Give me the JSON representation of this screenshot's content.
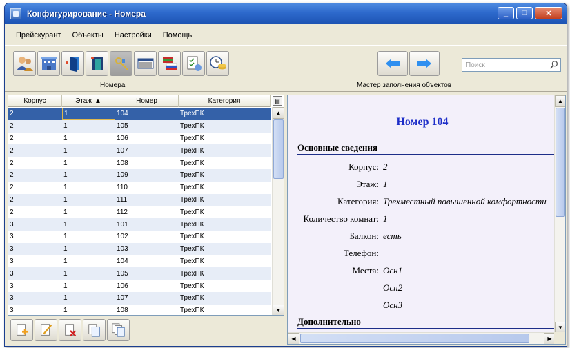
{
  "window": {
    "title": "Конфигурирование - Номера"
  },
  "menu": [
    "Прейскурант",
    "Объекты",
    "Настройки",
    "Помощь"
  ],
  "toolbar": {
    "left_icons": [
      "users-icon",
      "building-icon",
      "door-icon",
      "room-door-icon",
      "keys-icon",
      "price-table-icon",
      "flags-icon",
      "document-icon",
      "clock-money-icon"
    ],
    "left_caption": "Номера",
    "wizard_caption": "Мастер заполнения объектов",
    "search_placeholder": "Поиск"
  },
  "grid": {
    "columns": [
      "Корпус",
      "Этаж",
      "Номер",
      "Категория"
    ],
    "sort_indicator": "▲",
    "rows": [
      [
        "2",
        "1",
        "104",
        "ТрехПК"
      ],
      [
        "2",
        "1",
        "105",
        "ТрехПК"
      ],
      [
        "2",
        "1",
        "106",
        "ТрехПК"
      ],
      [
        "2",
        "1",
        "107",
        "ТрехПК"
      ],
      [
        "2",
        "1",
        "108",
        "ТрехПК"
      ],
      [
        "2",
        "1",
        "109",
        "ТрехПК"
      ],
      [
        "2",
        "1",
        "110",
        "ТрехПК"
      ],
      [
        "2",
        "1",
        "111",
        "ТрехПК"
      ],
      [
        "2",
        "1",
        "112",
        "ТрехПК"
      ],
      [
        "3",
        "1",
        "101",
        "ТрехПК"
      ],
      [
        "3",
        "1",
        "102",
        "ТрехПК"
      ],
      [
        "3",
        "1",
        "103",
        "ТрехПК"
      ],
      [
        "3",
        "1",
        "104",
        "ТрехПК"
      ],
      [
        "3",
        "1",
        "105",
        "ТрехПК"
      ],
      [
        "3",
        "1",
        "106",
        "ТрехПК"
      ],
      [
        "3",
        "1",
        "107",
        "ТрехПК"
      ],
      [
        "3",
        "1",
        "108",
        "ТрехПК"
      ]
    ]
  },
  "bottom_tools": [
    "add-icon",
    "edit-icon",
    "delete-icon",
    "copy-icon",
    "duplicate-icon"
  ],
  "detail": {
    "title": "Номер 104",
    "main_section": "Основные сведения",
    "fields": [
      {
        "label": "Корпус:",
        "value": "2"
      },
      {
        "label": "Этаж:",
        "value": "1"
      },
      {
        "label": "Категория:",
        "value": "Трехместный повышенной комфортности"
      },
      {
        "label": "Количество комнат:",
        "value": "1"
      },
      {
        "label": "Балкон:",
        "value": "есть"
      },
      {
        "label": "Телефон:",
        "value": ""
      },
      {
        "label": "Места:",
        "value": "Осн1"
      },
      {
        "label": "",
        "value": "Осн2"
      },
      {
        "label": "",
        "value": "Осн3"
      }
    ],
    "extra_section": "Дополнительно"
  }
}
